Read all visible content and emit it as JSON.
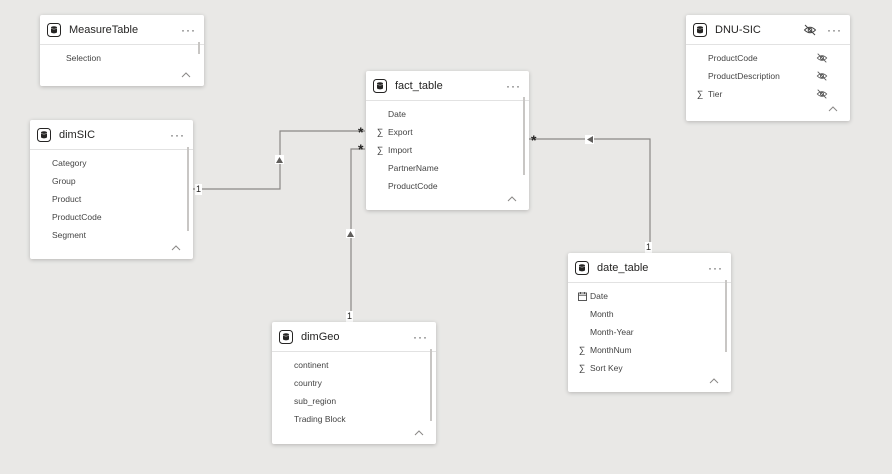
{
  "tables": {
    "measure": {
      "title": "MeasureTable",
      "fields": [
        {
          "label": "Selection",
          "icon": "none"
        }
      ]
    },
    "fact": {
      "title": "fact_table",
      "fields": [
        {
          "label": "Date",
          "icon": "none"
        },
        {
          "label": "Export",
          "icon": "sigma"
        },
        {
          "label": "Import",
          "icon": "sigma"
        },
        {
          "label": "PartnerName",
          "icon": "none"
        },
        {
          "label": "ProductCode",
          "icon": "none"
        }
      ]
    },
    "dnu": {
      "title": "DNU-SIC",
      "fields": [
        {
          "label": "ProductCode",
          "icon": "none"
        },
        {
          "label": "ProductDescription",
          "icon": "none"
        },
        {
          "label": "Tier",
          "icon": "sigma"
        }
      ]
    },
    "dimsic": {
      "title": "dimSIC",
      "fields": [
        {
          "label": "Category",
          "icon": "none"
        },
        {
          "label": "Group",
          "icon": "none"
        },
        {
          "label": "Product",
          "icon": "none"
        },
        {
          "label": "ProductCode",
          "icon": "none"
        },
        {
          "label": "Segment",
          "icon": "none"
        }
      ]
    },
    "date": {
      "title": "date_table",
      "fields": [
        {
          "label": "Date",
          "icon": "calendar"
        },
        {
          "label": "Month",
          "icon": "none"
        },
        {
          "label": "Month-Year",
          "icon": "none"
        },
        {
          "label": "MonthNum",
          "icon": "sigma"
        },
        {
          "label": "Sort Key",
          "icon": "sigma"
        }
      ]
    },
    "geo": {
      "title": "dimGeo",
      "fields": [
        {
          "label": "continent",
          "icon": "none"
        },
        {
          "label": "country",
          "icon": "none"
        },
        {
          "label": "sub_region",
          "icon": "none"
        },
        {
          "label": "Trading Block",
          "icon": "none"
        }
      ]
    }
  },
  "relationships": {
    "dimsic_fact": {
      "one": "1",
      "many": "*"
    },
    "geo_fact": {
      "one": "1",
      "many": "*"
    },
    "date_fact": {
      "one": "1",
      "many": "*"
    }
  },
  "ui": {
    "more_label": "···",
    "sigma_glyph": "∑"
  },
  "colors": {
    "canvas": "#e9e8e6",
    "card": "#ffffff",
    "line": "#8a8886",
    "text": "#252423"
  }
}
